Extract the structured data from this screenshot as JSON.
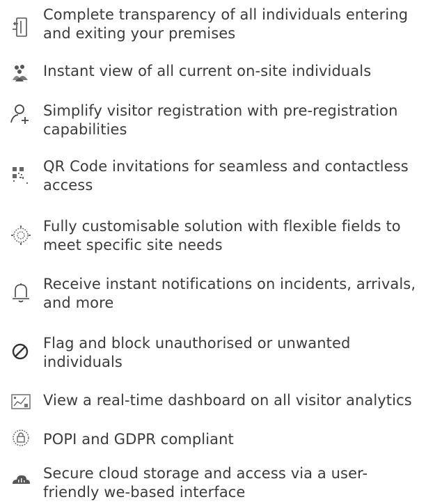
{
  "features": [
    {
      "icon": "door-exit-icon",
      "lines": [
        "Complete transparency of all individuals entering",
        "and exiting your premises"
      ]
    },
    {
      "icon": "people-group-icon",
      "lines": [
        "Instant view of all current on-site individuals"
      ]
    },
    {
      "icon": "add-person-icon",
      "lines": [
        "Simplify visitor registration with pre-registration",
        "capabilities"
      ]
    },
    {
      "icon": "qr-code-icon",
      "lines": [
        "QR Code invitations for seamless and contactless",
        "access"
      ]
    },
    {
      "icon": "gear-icon",
      "lines": [
        "Fully customisable solution with flexible fields to",
        "meet specific site needs"
      ]
    },
    {
      "icon": "bell-icon",
      "lines": [
        "Receive instant notifications on incidents, arrivals,",
        "and more"
      ]
    },
    {
      "icon": "block-icon",
      "lines": [
        "Flag and block unauthorised or unwanted",
        "individuals"
      ]
    },
    {
      "icon": "dashboard-icon",
      "lines": [
        "View a real-time dashboard on all visitor analytics"
      ]
    },
    {
      "icon": "shield-lock-icon",
      "lines": [
        "POPI and GDPR compliant"
      ]
    },
    {
      "icon": "cloud-icon",
      "lines": [
        "Secure cloud storage and access via a user-",
        "friendly we-based interface"
      ]
    }
  ]
}
